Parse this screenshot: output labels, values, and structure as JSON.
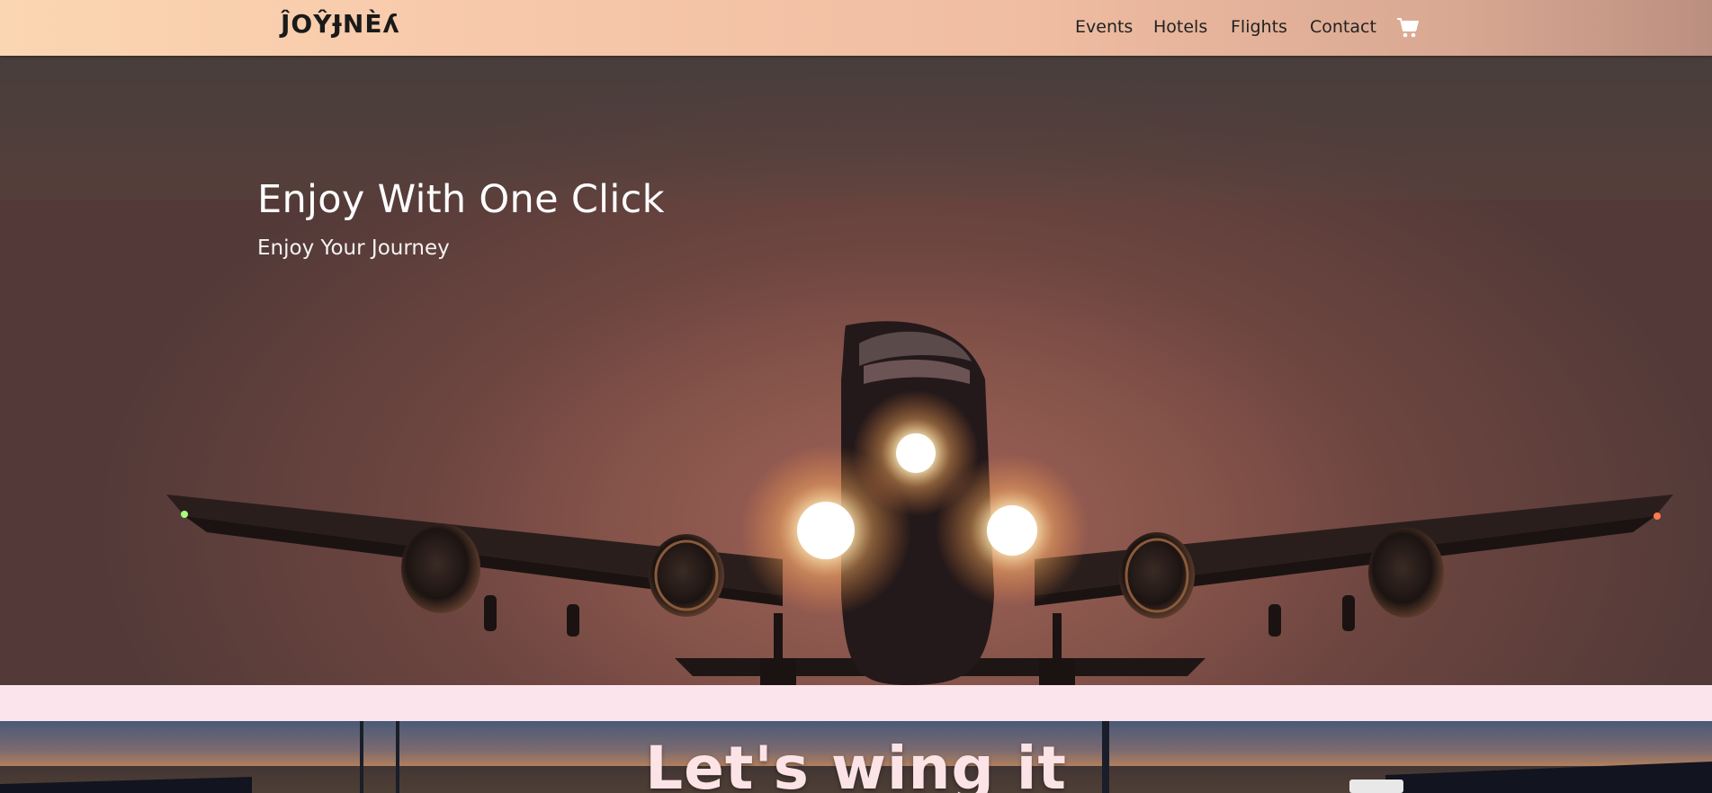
{
  "navbar": {
    "brand": "ĴOŶɈNÈʎ",
    "links": [
      "Events",
      "Hotels",
      "Flights",
      "Contact"
    ],
    "cart_icon": "shopping-cart-icon"
  },
  "hero": {
    "title": "Enjoy With One Click",
    "subtitle": "Enjoy Your Journey"
  },
  "section2": {
    "title": "Let's wing it"
  },
  "colors": {
    "navbar_gradient_start": "#fbd6b2",
    "navbar_gradient_end": "#bb8f80",
    "page_background": "#fce4ec",
    "hero_text": "#ffffff"
  }
}
